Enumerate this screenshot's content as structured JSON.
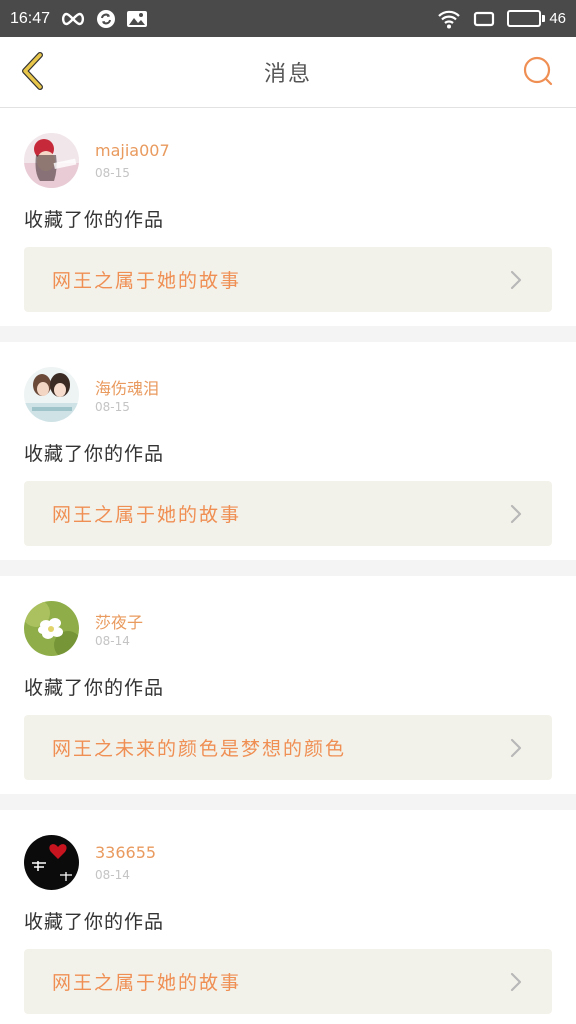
{
  "status_bar": {
    "time": "16:47",
    "battery": "46",
    "battery_level": 0.46
  },
  "nav": {
    "title": "消息",
    "back_icon": "chevron-left-icon",
    "search_icon": "search-icon"
  },
  "colors": {
    "accent": "#ef8f54",
    "back_icon": "#e8c64a",
    "status_bar_bg": "#4a4a4a",
    "card_box_bg": "#f3f2ea"
  },
  "messages": [
    {
      "username": "majia007",
      "date": "08-15",
      "action": "收藏了你的作品",
      "work_title": "网王之属于她的故事"
    },
    {
      "username": "海伤魂泪",
      "date": "08-15",
      "action": "收藏了你的作品",
      "work_title": "网王之属于她的故事"
    },
    {
      "username": "莎夜子",
      "date": "08-14",
      "action": "收藏了你的作品",
      "work_title": "网王之未来的颜色是梦想的颜色"
    },
    {
      "username": "336655",
      "date": "08-14",
      "action": "收藏了你的作品",
      "work_title": "网王之属于她的故事"
    }
  ]
}
